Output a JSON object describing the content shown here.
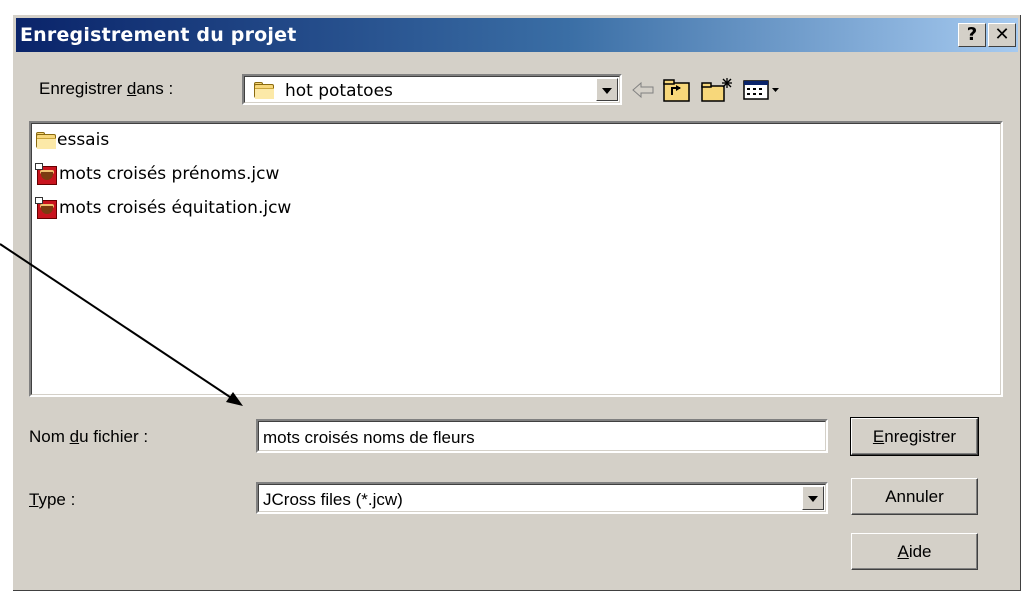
{
  "window": {
    "title": "Enregistrement du projet",
    "help_label": "?",
    "close_label": "✕"
  },
  "location": {
    "label_pre": "Enregistrer ",
    "label_ul": "d",
    "label_post": "ans :",
    "value": "hot potatoes"
  },
  "toolbar": {
    "icons": [
      "back-arrow-icon",
      "up-folder-icon",
      "new-folder-icon",
      "view-menu-icon"
    ]
  },
  "files": [
    {
      "name": "essais",
      "icon": "folder-icon"
    },
    {
      "name": "mots croisés prénoms.jcw",
      "icon": "jcross-file-icon"
    },
    {
      "name": "mots croisés équitation.jcw",
      "icon": "jcross-file-icon"
    }
  ],
  "filename": {
    "label_pre": "Nom ",
    "label_ul": "d",
    "label_post": "u fichier :",
    "value": "mots croisés noms de fleurs"
  },
  "filetype": {
    "label_ul": "T",
    "label_post": "ype :",
    "value": "JCross files (*.jcw)"
  },
  "buttons": {
    "save_ul": "E",
    "save_post": "nregistrer",
    "cancel": "Annuler",
    "help_ul": "A",
    "help_post": "ide"
  },
  "colors": {
    "title_start": "#0a246a",
    "title_end": "#a6caf0",
    "dialog_bg": "#d4d0c8"
  }
}
